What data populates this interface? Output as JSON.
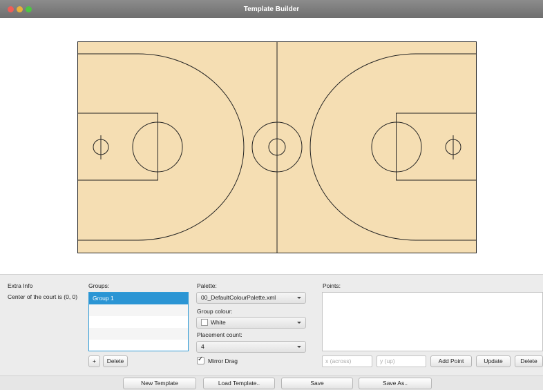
{
  "window": {
    "title": "Template Builder"
  },
  "court": {
    "surface_color": "#f5deb3",
    "line_color": "#222222"
  },
  "extra_info": {
    "heading": "Extra Info",
    "text": "Center of the court is (0, 0)"
  },
  "groups": {
    "label": "Groups:",
    "items": [
      "Group 1"
    ],
    "add_label": "+",
    "delete_label": "Delete"
  },
  "palette": {
    "label": "Palette:",
    "selected": "00_DefaultColourPalette.xml",
    "group_colour_label": "Group colour:",
    "group_colour_value": "White",
    "placement_count_label": "Placement count:",
    "placement_count_value": "4",
    "mirror_drag_label": "Mirror Drag",
    "mirror_drag_checked": true
  },
  "points": {
    "label": "Points:",
    "x_placeholder": "x (across)",
    "y_placeholder": "y (up)",
    "add_label": "Add Point",
    "update_label": "Update",
    "delete_label": "Delete"
  },
  "footer": {
    "new_template": "New Template",
    "load_template": "Load Template..",
    "save": "Save",
    "save_as": "Save As.."
  }
}
